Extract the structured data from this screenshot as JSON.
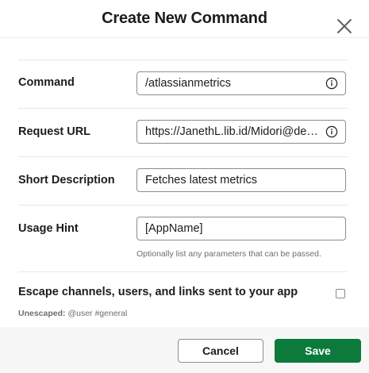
{
  "dialog": {
    "title": "Create New Command"
  },
  "form": {
    "command": {
      "label": "Command",
      "value": "/atlassianmetrics"
    },
    "request_url": {
      "label": "Request URL",
      "value": "https://JanethL.lib.id/Midori@dev/c..."
    },
    "short_description": {
      "label": "Short Description",
      "value": "Fetches latest metrics"
    },
    "usage_hint": {
      "label": "Usage Hint",
      "value": "[AppName]",
      "help": "Optionally list any parameters that can be passed."
    },
    "escape": {
      "label": "Escape channels, users, and links sent to your app",
      "checked": false,
      "status_label": "Unescaped:",
      "status_value": "@user #general"
    }
  },
  "footer": {
    "cancel_label": "Cancel",
    "save_label": "Save"
  },
  "colors": {
    "save_button": "#0b7a3b",
    "footer_bg": "#f7f7f7",
    "border": "#8d8d8d"
  },
  "icons": {
    "close": "close-icon",
    "info": "info-icon"
  }
}
